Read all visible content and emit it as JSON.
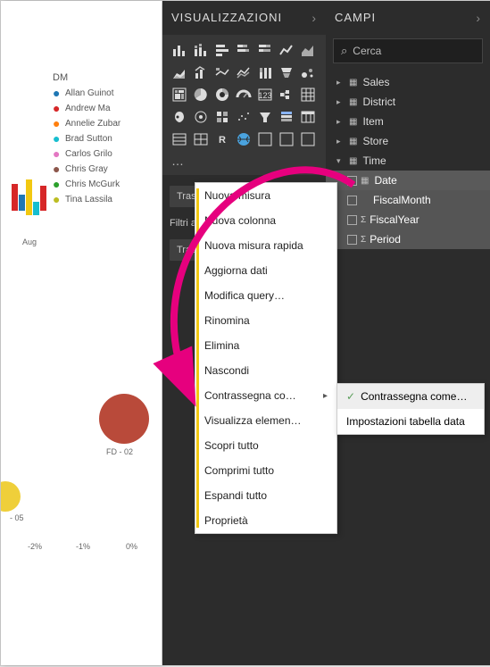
{
  "panes": {
    "viz_title": "VISUALIZZAZIONI",
    "fields_title": "CAMPI"
  },
  "search": {
    "placeholder": "Cerca"
  },
  "legend": {
    "title": "DM",
    "items": [
      {
        "name": "Allan Guinot",
        "color": "#1f77b4"
      },
      {
        "name": "Andrew Ma",
        "color": "#d62728"
      },
      {
        "name": "Annelie Zubar",
        "color": "#ff7f0e"
      },
      {
        "name": "Brad Sutton",
        "color": "#17becf"
      },
      {
        "name": "Carlos Grilo",
        "color": "#e377c2"
      },
      {
        "name": "Chris Gray",
        "color": "#8c564b"
      },
      {
        "name": "Chris McGurk",
        "color": "#2ca02c"
      },
      {
        "name": "Tina Lassila",
        "color": "#bcbd22"
      }
    ]
  },
  "axis": {
    "aug": "Aug",
    "t_neg2": "-2%",
    "t_neg1": "-1%",
    "t_0": "0%"
  },
  "bubble_labels": {
    "fd02": "FD - 02",
    "fd05": "- 05"
  },
  "tables": {
    "sales": "Sales",
    "district": "District",
    "item": "Item",
    "store": "Store",
    "time": "Time",
    "time_children": {
      "date": "Date",
      "fiscalmonth": "FiscalMonth",
      "fiscalyear": "FiscalYear",
      "period": "Period"
    }
  },
  "drag_hints": {
    "drill": "Trascinare qui i campi di dri…",
    "report_filters": "Filtri a livello di report",
    "data": "Trascinare qui i campi dati"
  },
  "context_menu": [
    "Nuova misura",
    "Nuova colonna",
    "Nuova misura rapida",
    "Aggiorna dati",
    "Modifica query…",
    "Rinomina",
    "Elimina",
    "Nascondi",
    "Contrassegna co…",
    "Visualizza elemen…",
    "Scopri tutto",
    "Comprimi tutto",
    "Espandi tutto",
    "Proprietà"
  ],
  "submenu": {
    "mark_as": "Contrassegna come…",
    "date_table_settings": "Impostazioni tabella data"
  },
  "chart_data": {
    "type": "bar",
    "categories": [
      "Aug"
    ],
    "series": [
      {
        "name": "Allan Guinot",
        "color": "#1f77b4"
      },
      {
        "name": "Andrew Ma",
        "color": "#d62728"
      },
      {
        "name": "Brad Sutton",
        "color": "#17becf"
      },
      {
        "name": "Chris Gray",
        "color": "#f2c811"
      }
    ],
    "note": "Partial clipped bar chart; values not readable from image"
  }
}
